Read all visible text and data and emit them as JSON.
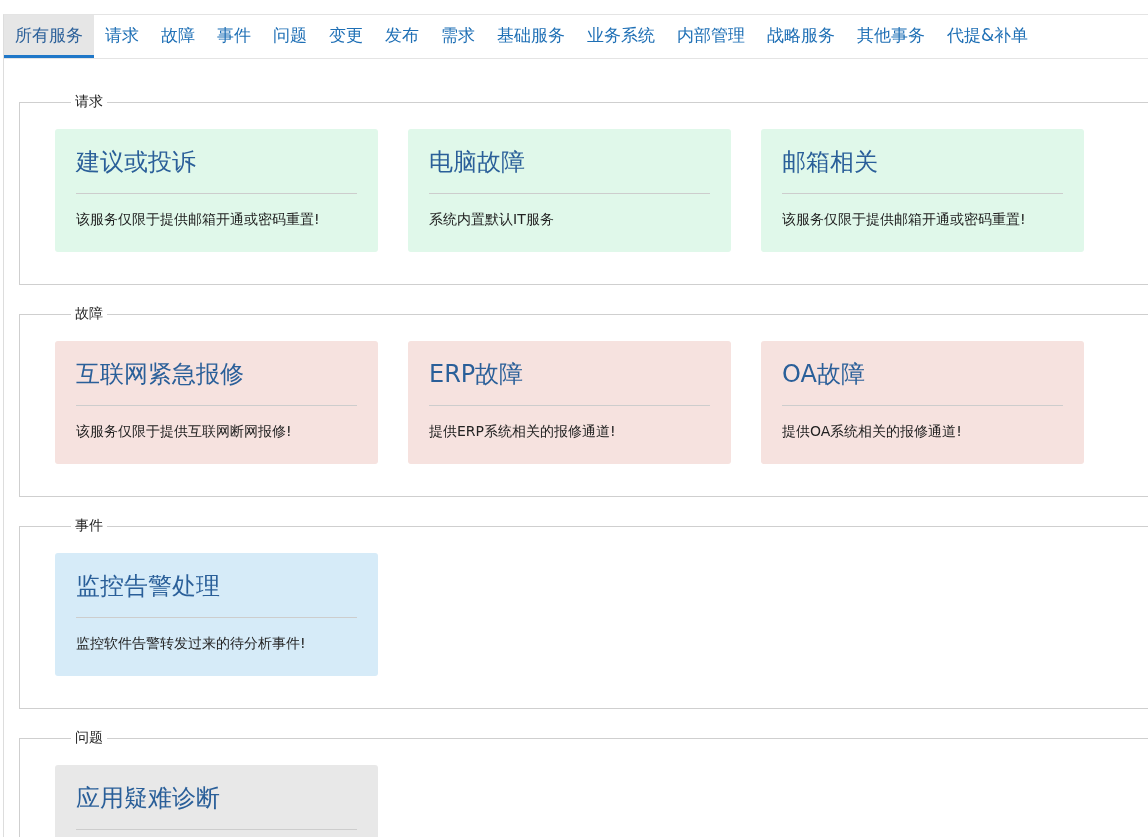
{
  "tabs": [
    {
      "label": "所有服务",
      "selected": true
    },
    {
      "label": "请求",
      "selected": false
    },
    {
      "label": "故障",
      "selected": false
    },
    {
      "label": "事件",
      "selected": false
    },
    {
      "label": "问题",
      "selected": false
    },
    {
      "label": "变更",
      "selected": false
    },
    {
      "label": "发布",
      "selected": false
    },
    {
      "label": "需求",
      "selected": false
    },
    {
      "label": "基础服务",
      "selected": false
    },
    {
      "label": "业务系统",
      "selected": false
    },
    {
      "label": "内部管理",
      "selected": false
    },
    {
      "label": "战略服务",
      "selected": false
    },
    {
      "label": "其他事务",
      "selected": false
    },
    {
      "label": "代提&补单",
      "selected": false
    }
  ],
  "sections": [
    {
      "title": "请求",
      "color": "#e0f8ea",
      "cards": [
        {
          "title": "建议或投诉",
          "description": "该服务仅限于提供邮箱开通或密码重置!"
        },
        {
          "title": "电脑故障",
          "description": "系统内置默认IT服务"
        },
        {
          "title": "邮箱相关",
          "description": "该服务仅限于提供邮箱开通或密码重置!"
        }
      ]
    },
    {
      "title": "故障",
      "color": "#f6e2df",
      "cards": [
        {
          "title": "互联网紧急报修",
          "description": "该服务仅限于提供互联网断网报修!"
        },
        {
          "title": "ERP故障",
          "description": "提供ERP系统相关的报修通道!"
        },
        {
          "title": "OA故障",
          "description": "提供OA系统相关的报修通道!"
        }
      ]
    },
    {
      "title": "事件",
      "color": "#d6ebf8",
      "cards": [
        {
          "title": "监控告警处理",
          "description": "监控软件告警转发过来的待分析事件!"
        }
      ]
    },
    {
      "title": "问题",
      "color": "#e8e8e8",
      "cards": [
        {
          "title": "应用疑难诊断"
        }
      ]
    }
  ]
}
